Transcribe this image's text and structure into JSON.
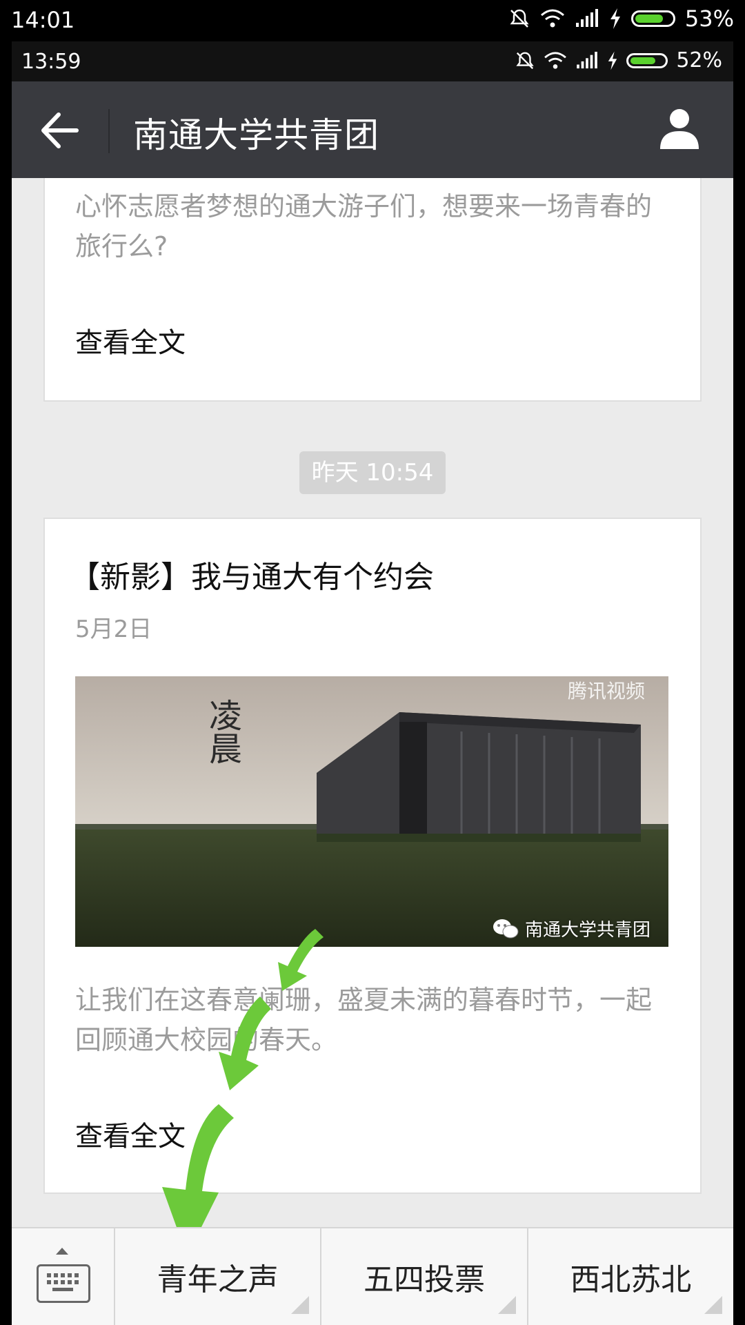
{
  "outer_status": {
    "time": "14:01",
    "battery": "53%"
  },
  "inner_status": {
    "time": "13:59",
    "battery": "52%"
  },
  "header": {
    "title": "南通大学共青团",
    "back_icon": "arrow-left-icon",
    "profile_icon": "user-profile-icon"
  },
  "messages": {
    "card1": {
      "description": "心怀志愿者梦想的通大游子们，想要来一场青春的旅行么?",
      "read_more": "查看全文"
    },
    "timestamp": "昨天 10:54",
    "card2": {
      "title": "【新影】我与通大有个约会",
      "date": "5月2日",
      "cover_calligraphy": "凌晨",
      "cover_watermark": "南通大学共青团",
      "cover_logo": "腾讯视频",
      "description": "让我们在这春意阑珊，盛夏未满的暮春时节，一起回顾通大校园的春天。",
      "read_more": "查看全文"
    }
  },
  "menu": {
    "keyboard_icon": "keyboard-icon",
    "items": [
      "青年之声",
      "五四投票",
      "西北苏北"
    ]
  },
  "colors": {
    "header_bg": "#393a3f",
    "content_bg": "#ebebeb",
    "arrow_green": "#6cc93a"
  }
}
